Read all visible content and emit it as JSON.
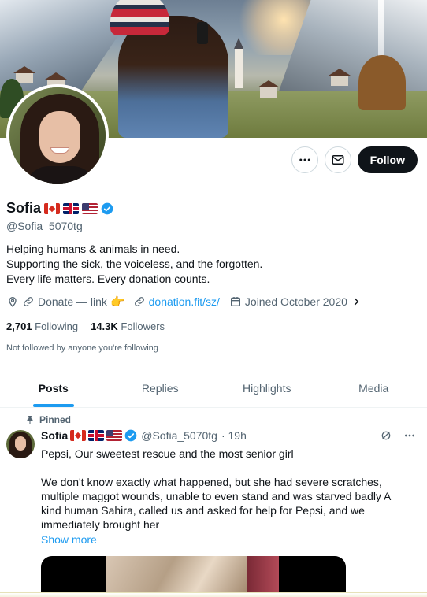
{
  "profile": {
    "display_name": "Sofia",
    "handle": "@Sofia_5070tg",
    "bio_lines": [
      "Helping humans & animals in need.",
      "Supporting the sick, the voiceless, and the forgotten.",
      "Every life matters. Every donation counts."
    ],
    "meta": {
      "donate_text": "Donate — link",
      "link_text": "donation.fit/sz/",
      "joined_text": "Joined October 2020"
    },
    "stats": {
      "following_count": "2,701",
      "following_label": "Following",
      "followers_count": "14.3K",
      "followers_label": "Followers"
    },
    "not_followed_text": "Not followed by anyone you're following",
    "flags": [
      "flag-canada-icon",
      "flag-uk-icon",
      "flag-us-icon"
    ]
  },
  "actions": {
    "follow_label": "Follow"
  },
  "tabs": [
    {
      "label": "Posts",
      "active": true
    },
    {
      "label": "Replies",
      "active": false
    },
    {
      "label": "Highlights",
      "active": false
    },
    {
      "label": "Media",
      "active": false
    }
  ],
  "post": {
    "pinned_label": "Pinned",
    "author_name": "Sofia",
    "author_handle": "@Sofia_5070tg",
    "time": "· 19h",
    "text_line1": "Pepsi, Our sweetest rescue and the most senior girl",
    "text_para2": "We don't know exactly what happened, but she had severe scratches, multiple maggot wounds, unable to even stand and was starved badly A kind human Sahira, called us and asked for help for Pepsi, and we immediately brought her",
    "show_more": "Show more"
  },
  "colors": {
    "accent": "#1d9bf0",
    "text": "#0f1419",
    "secondary": "#536471",
    "follow_bg": "#0f1419"
  }
}
